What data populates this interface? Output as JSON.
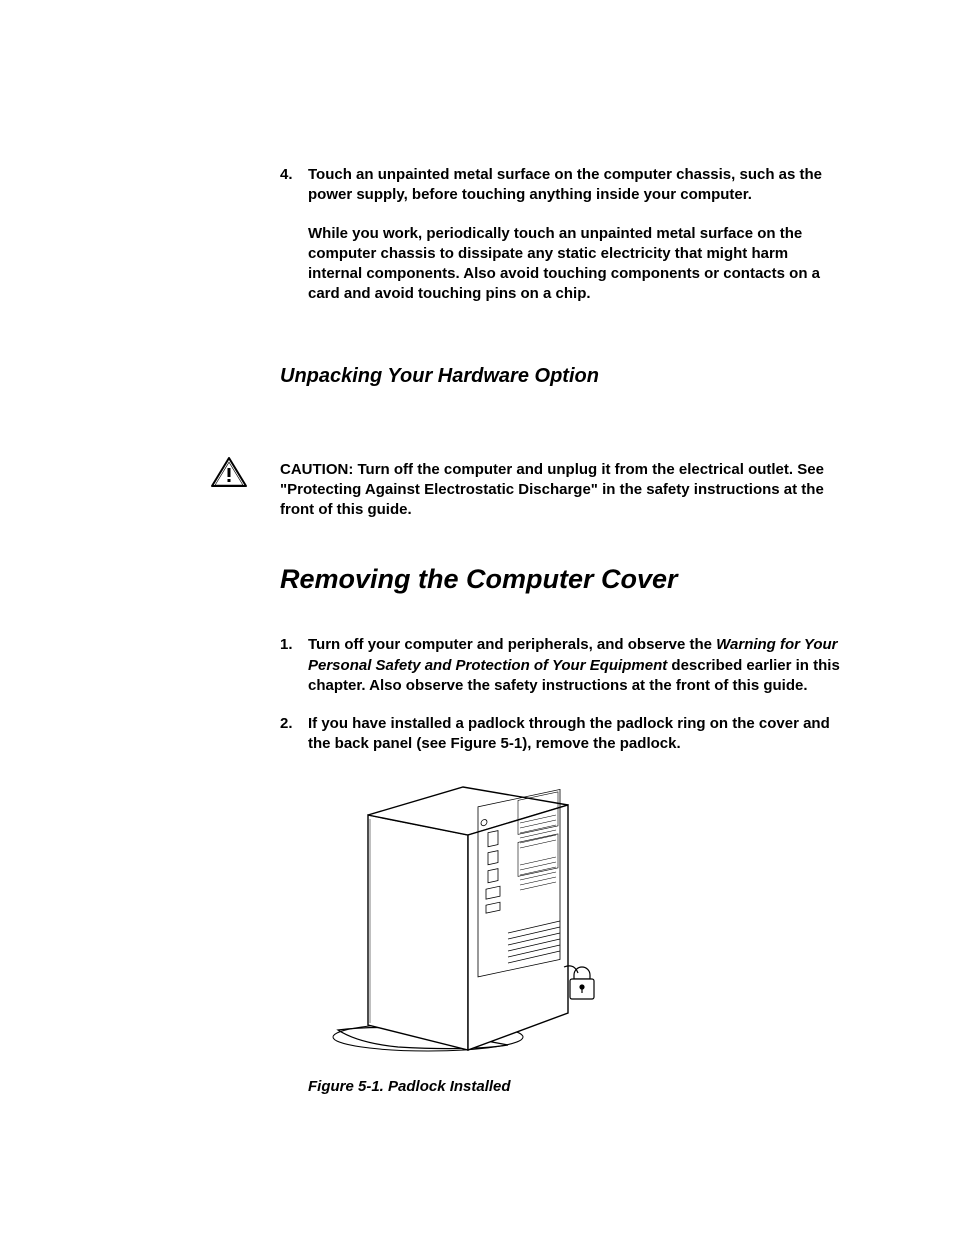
{
  "step4": {
    "num": "4.",
    "text": "Touch an unpainted metal surface on the computer chassis, such as the power supply, before touching anything inside your computer.",
    "sub": "While you work, periodically touch an unpainted metal surface on the computer chassis to dissipate any static electricity that might harm internal components. Also avoid touching components or contacts on a card and avoid touching pins on a chip."
  },
  "subheading": "Unpacking Your Hardware Option",
  "caution": {
    "label": "CAUTION:",
    "text": " Turn off the computer and unplug it from the electrical outlet. See \"Protecting Against Electrostatic Discharge\" in the safety instructions at the front of this guide."
  },
  "heading": "Removing the Computer Cover",
  "steps": {
    "s1": {
      "num": "1.",
      "pre": "Turn off your computer and peripherals, and observe the ",
      "em": "Warning for Your Personal Safety and Protection of Your Equipment",
      "post": " described earlier in this chapter. Also observe the safety instructions at the front of this guide."
    },
    "s2": {
      "num": "2.",
      "text": "If you have installed a padlock through the padlock ring on the cover and the back panel (see Figure 5-1), remove the padlock."
    }
  },
  "figure": {
    "caption": "Figure 5-1.  Padlock Installed"
  }
}
